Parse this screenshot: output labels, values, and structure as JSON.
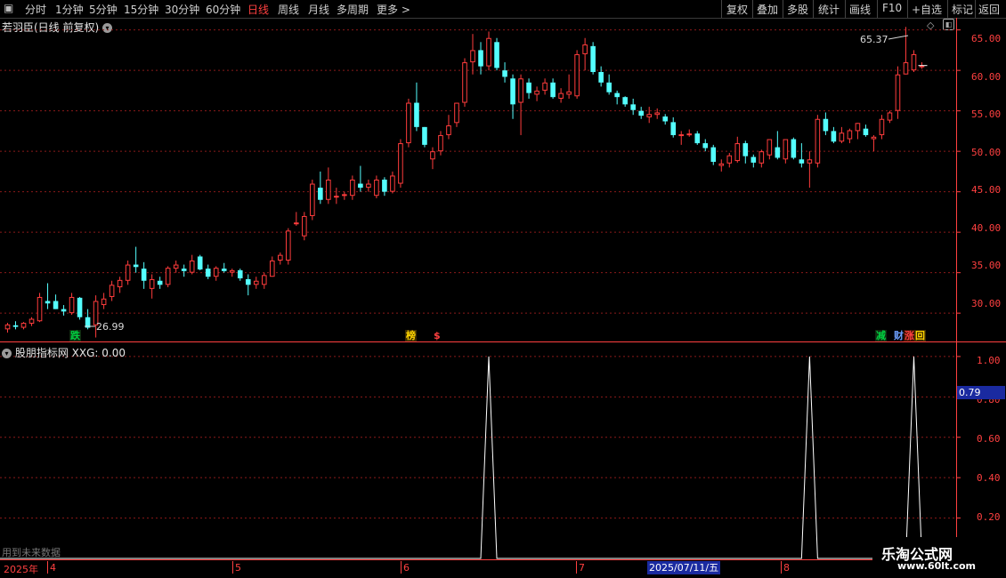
{
  "toolbar": {
    "left": [
      "分时",
      "1分钟",
      "5分钟",
      "15分钟",
      "30分钟",
      "60分钟",
      "日线",
      "周线",
      "月线",
      "多周期",
      "更多"
    ],
    "active": "日线",
    "right": [
      "复权",
      "叠加",
      "多股",
      "统计",
      "画线",
      "F10",
      "+自选",
      "标记",
      "返回"
    ]
  },
  "main_chart": {
    "title": "若羽臣(日线 前复权)",
    "price_axis": [
      "65.00",
      "60.00",
      "55.00",
      "50.00",
      "45.00",
      "40.00",
      "35.00",
      "30.00"
    ],
    "high_label": "65.37",
    "low_label": "26.99",
    "markers": [
      {
        "text": "跌",
        "color": "#00d040",
        "bg": "#102a10"
      },
      {
        "text": "榜",
        "color": "#ffd400",
        "bg": "#3a2a00"
      },
      {
        "text": "$",
        "color": "#ff4040",
        "bg": "#000000"
      },
      {
        "text": "减",
        "color": "#00d040",
        "bg": "#102a10"
      },
      {
        "text": "财",
        "color": "#6ea0ff",
        "bg": "#000000"
      },
      {
        "text": "涨",
        "color": "#ff4040",
        "bg": "#3a1000"
      },
      {
        "text": "回",
        "color": "#ffd400",
        "bg": "#3a2a00"
      }
    ]
  },
  "indicator": {
    "title": "股朋指标网 XXG: 0.00",
    "axis": [
      "1.00",
      "0.80",
      "0.60",
      "0.40",
      "0.20"
    ],
    "cursor_value": "0.79",
    "note": "用到未来数据"
  },
  "date_axis": {
    "labels": [
      "2025年",
      "4",
      "5",
      "6",
      "7",
      "8"
    ],
    "highlight": "2025/07/11/五"
  },
  "watermark": {
    "line1": "乐淘公式网",
    "line2": "www.60lt.com"
  },
  "colors": {
    "up": "#ff3c3c",
    "down": "#54ffff",
    "grid": "#8b1a1a",
    "axis": "#ff4040"
  },
  "chart_data": {
    "type": "candlestick",
    "series": [
      {
        "values": [
          [
            28.0,
            28.8,
            27.6,
            28.6
          ],
          [
            28.5,
            29.0,
            28.0,
            28.3
          ],
          [
            28.2,
            28.9,
            28.0,
            28.8
          ],
          [
            28.7,
            29.5,
            28.4,
            29.3
          ],
          [
            29.0,
            32.5,
            28.9,
            32.0
          ],
          [
            31.5,
            33.7,
            30.5,
            31.2
          ],
          [
            31.5,
            32.3,
            30.5,
            30.5
          ],
          [
            30.5,
            31.0,
            29.7,
            30.2
          ],
          [
            30.0,
            32.5,
            29.8,
            32.0
          ],
          [
            31.9,
            32.0,
            29.2,
            29.5
          ],
          [
            29.5,
            30.5,
            28.0,
            28.2
          ],
          [
            28.5,
            32.2,
            26.99,
            31.5
          ],
          [
            31.0,
            32.5,
            30.5,
            31.8
          ],
          [
            32.0,
            34.0,
            31.5,
            33.5
          ],
          [
            33.2,
            34.5,
            32.5,
            34.1
          ],
          [
            34.0,
            36.5,
            33.5,
            36.0
          ],
          [
            36.0,
            38.2,
            35.0,
            35.7
          ],
          [
            35.5,
            36.3,
            33.0,
            34.0
          ],
          [
            33.0,
            34.8,
            31.8,
            34.2
          ],
          [
            34.0,
            34.5,
            33.0,
            33.5
          ],
          [
            33.5,
            35.8,
            33.2,
            35.6
          ],
          [
            35.5,
            36.5,
            35.0,
            36.0
          ],
          [
            35.5,
            36.0,
            34.5,
            35.2
          ],
          [
            35.0,
            37.2,
            34.8,
            36.5
          ],
          [
            37.0,
            37.2,
            35.3,
            35.4
          ],
          [
            35.5,
            36.0,
            34.2,
            34.5
          ],
          [
            34.5,
            35.8,
            34.0,
            35.6
          ],
          [
            35.5,
            36.2,
            35.0,
            35.2
          ],
          [
            35.0,
            35.5,
            34.5,
            35.3
          ],
          [
            35.3,
            35.5,
            34.0,
            34.3
          ],
          [
            34.2,
            34.8,
            32.2,
            33.5
          ],
          [
            33.5,
            34.5,
            33.0,
            34.0
          ],
          [
            33.5,
            35.0,
            33.0,
            34.7
          ],
          [
            34.5,
            37.0,
            34.5,
            36.5
          ],
          [
            36.5,
            37.5,
            36.0,
            37.2
          ],
          [
            36.5,
            40.5,
            36.0,
            40.2
          ],
          [
            41.0,
            42.5,
            40.8,
            41.2
          ],
          [
            39.5,
            42.5,
            39.0,
            42.0
          ],
          [
            42.0,
            46.5,
            41.5,
            46.0
          ],
          [
            45.5,
            47.5,
            43.5,
            44.0
          ],
          [
            44.0,
            48.0,
            43.5,
            46.5
          ],
          [
            44.5,
            45.5,
            43.5,
            44.5
          ],
          [
            44.5,
            45.0,
            44.0,
            44.7
          ],
          [
            44.5,
            47.0,
            44.0,
            46.5
          ],
          [
            46.0,
            48.2,
            45.0,
            45.5
          ],
          [
            45.5,
            46.5,
            45.0,
            46.0
          ],
          [
            44.5,
            47.0,
            44.2,
            46.5
          ],
          [
            46.5,
            46.8,
            44.5,
            45.0
          ],
          [
            45.0,
            47.5,
            44.8,
            47.0
          ],
          [
            46.0,
            51.5,
            45.5,
            51.0
          ],
          [
            51.0,
            56.5,
            50.5,
            56.0
          ],
          [
            56.0,
            58.5,
            52.5,
            53.0
          ],
          [
            53.0,
            53.0,
            50.5,
            50.8
          ],
          [
            49.0,
            50.5,
            47.8,
            50.0
          ],
          [
            50.0,
            52.5,
            49.5,
            52.0
          ],
          [
            52.0,
            54.5,
            51.5,
            53.2
          ],
          [
            53.5,
            56.0,
            53.0,
            56.0
          ],
          [
            56.0,
            61.5,
            55.5,
            61.0
          ],
          [
            61.0,
            64.5,
            59.5,
            62.5
          ],
          [
            62.5,
            63.5,
            59.5,
            60.5
          ],
          [
            60.5,
            64.8,
            60.0,
            64.0
          ],
          [
            63.5,
            64.0,
            60.0,
            60.3
          ],
          [
            60.0,
            61.0,
            58.5,
            59.2
          ],
          [
            59.0,
            59.5,
            54.0,
            55.8
          ],
          [
            56.0,
            59.5,
            52.0,
            59.0
          ],
          [
            58.5,
            59.0,
            56.5,
            57.2
          ],
          [
            57.0,
            58.0,
            56.2,
            57.5
          ],
          [
            57.5,
            59.0,
            57.0,
            58.5
          ],
          [
            58.5,
            59.0,
            56.5,
            56.7
          ],
          [
            56.5,
            57.8,
            56.0,
            57.2
          ],
          [
            57.0,
            59.5,
            56.5,
            57.4
          ],
          [
            56.8,
            62.5,
            56.5,
            62.0
          ],
          [
            62.0,
            64.0,
            60.0,
            63.2
          ],
          [
            63.0,
            63.5,
            59.5,
            59.8
          ],
          [
            59.8,
            60.5,
            58.0,
            58.5
          ],
          [
            58.5,
            59.5,
            57.0,
            57.3
          ],
          [
            57.2,
            57.5,
            55.8,
            56.7
          ],
          [
            56.7,
            56.8,
            55.5,
            55.8
          ],
          [
            55.8,
            56.5,
            54.5,
            55.1
          ],
          [
            55.0,
            55.5,
            54.0,
            54.4
          ],
          [
            54.2,
            55.5,
            53.5,
            54.6
          ],
          [
            54.5,
            55.3,
            54.0,
            54.8
          ],
          [
            54.3,
            54.6,
            53.3,
            53.7
          ],
          [
            53.6,
            54.2,
            51.7,
            52.0
          ],
          [
            52.0,
            52.5,
            50.8,
            52.1
          ],
          [
            52.0,
            52.7,
            51.8,
            52.2
          ],
          [
            52.2,
            52.5,
            50.8,
            51.0
          ],
          [
            51.0,
            51.5,
            50.0,
            50.4
          ],
          [
            50.5,
            50.8,
            48.3,
            48.7
          ],
          [
            48.2,
            49.0,
            47.5,
            48.5
          ],
          [
            48.5,
            49.8,
            48.0,
            49.5
          ],
          [
            48.8,
            51.8,
            48.6,
            51.0
          ],
          [
            51.0,
            51.3,
            48.5,
            49.4
          ],
          [
            49.3,
            49.6,
            48.0,
            48.6
          ],
          [
            48.5,
            50.2,
            48.0,
            50.0
          ],
          [
            49.5,
            51.5,
            49.0,
            51.5
          ],
          [
            50.5,
            52.5,
            49.0,
            49.2
          ],
          [
            49.0,
            51.5,
            48.5,
            51.5
          ],
          [
            51.5,
            51.7,
            49.0,
            49.2
          ],
          [
            49.0,
            51.0,
            48.0,
            48.5
          ],
          [
            48.5,
            50.0,
            45.5,
            49.0
          ],
          [
            48.5,
            54.5,
            48.0,
            54.0
          ],
          [
            54.0,
            54.8,
            52.0,
            52.5
          ],
          [
            52.5,
            53.0,
            51.0,
            51.2
          ],
          [
            51.2,
            53.0,
            51.0,
            52.3
          ],
          [
            51.5,
            52.8,
            51.0,
            52.6
          ],
          [
            52.5,
            53.5,
            51.5,
            53.5
          ],
          [
            52.8,
            53.3,
            51.8,
            52.0
          ],
          [
            51.5,
            52.0,
            50.0,
            51.8
          ],
          [
            52.0,
            54.5,
            51.5,
            54.0
          ],
          [
            53.8,
            55.0,
            53.5,
            54.8
          ],
          [
            55.0,
            60.5,
            54.0,
            59.5
          ],
          [
            59.5,
            65.37,
            59.5,
            61.0
          ],
          [
            60.0,
            62.5,
            59.8,
            62.0
          ],
          [
            60.6,
            61.0,
            60.2,
            60.6
          ]
        ]
      }
    ],
    "xlabels": [
      "2025年",
      "4",
      "5",
      "6",
      "7",
      "8"
    ],
    "ylim": [
      26.5,
      66.5
    ],
    "indicator_series": {
      "name": "XXG",
      "peaks_at_candle": [
        60,
        100,
        113
      ],
      "peak_value": 1.0,
      "ylim": [
        0,
        1.07
      ]
    }
  }
}
